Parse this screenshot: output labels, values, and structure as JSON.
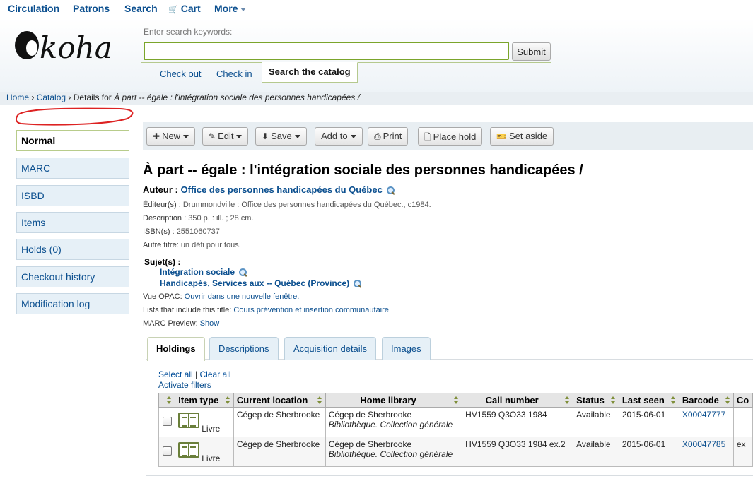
{
  "topnav": {
    "circulation": "Circulation",
    "patrons": "Patrons",
    "search": "Search",
    "cart": "Cart",
    "more": "More"
  },
  "header": {
    "logo": "koha",
    "search_label": "Enter search keywords:",
    "search_value": "",
    "submit": "Submit",
    "tabs": {
      "checkout": "Check out",
      "checkin": "Check in",
      "catalog": "Search the catalog"
    }
  },
  "breadcrumb": {
    "home": "Home",
    "catalog": "Catalog",
    "details_prefix": "Details for",
    "details_title": "À part -- égale : l'intégration sociale des personnes handicapées /"
  },
  "sidebar": {
    "items": [
      {
        "label": "Normal"
      },
      {
        "label": "MARC"
      },
      {
        "label": "ISBD"
      },
      {
        "label": "Items"
      },
      {
        "label": "Holds (0)"
      },
      {
        "label": "Checkout history"
      },
      {
        "label": "Modification log"
      }
    ]
  },
  "toolbar": {
    "new": "New",
    "edit": "Edit",
    "save": "Save",
    "addto": "Add to",
    "print": "Print",
    "placehold": "Place hold",
    "setaside": "Set aside"
  },
  "record": {
    "title": "À part -- égale : l'intégration sociale des personnes handicapées /",
    "author_label": "Auteur :",
    "author": "Office des personnes handicapées du Québec",
    "publisher_label": "Éditeur(s) :",
    "publisher": "Drummondville : Office des personnes handicapées du Québec., c1984.",
    "description_label": "Description :",
    "description": "350 p. : ill. ; 28 cm.",
    "isbn_label": "ISBN(s) :",
    "isbn": "2551060737",
    "other_title_label": "Autre titre:",
    "other_title": "un défi pour tous.",
    "subjects_label": "Sujet(s) :",
    "subjects": [
      "Intégration sociale",
      "Handicapés, Services aux -- Québec (Province)"
    ],
    "opac_label": "Vue OPAC:",
    "opac_link": "Ouvrir dans une nouvelle fenêtre.",
    "lists_label": "Lists that include this title:",
    "lists_link": "Cours prévention et insertion communautaire",
    "marc_preview_label": "MARC Preview:",
    "marc_preview_link": "Show"
  },
  "holdings_tabs": {
    "holdings": "Holdings",
    "descriptions": "Descriptions",
    "acquisition": "Acquisition details",
    "images": "Images"
  },
  "holdings": {
    "select_all": "Select all",
    "separator": "|",
    "clear_all": "Clear all",
    "activate_filters": "Activate filters",
    "columns": [
      "Item type",
      "Current location",
      "Home library",
      "Call number",
      "Status",
      "Last seen",
      "Barcode",
      "Co"
    ],
    "rows": [
      {
        "item_type": "Livre",
        "current_location": "Cégep de Sherbrooke",
        "home_library": "Cégep de Sherbrooke",
        "home_collection": "Bibliothèque. Collection générale",
        "call_number": "HV1559 Q3O33 1984",
        "status": "Available",
        "last_seen": "2015-06-01",
        "barcode": "X00047777",
        "extra": ""
      },
      {
        "item_type": "Livre",
        "current_location": "Cégep de Sherbrooke",
        "home_library": "Cégep de Sherbrooke",
        "home_collection": "Bibliothèque. Collection générale",
        "call_number": "HV1559 Q3O33 1984 ex.2",
        "status": "Available",
        "last_seen": "2015-06-01",
        "barcode": "X00047785",
        "extra": "ex"
      }
    ]
  }
}
